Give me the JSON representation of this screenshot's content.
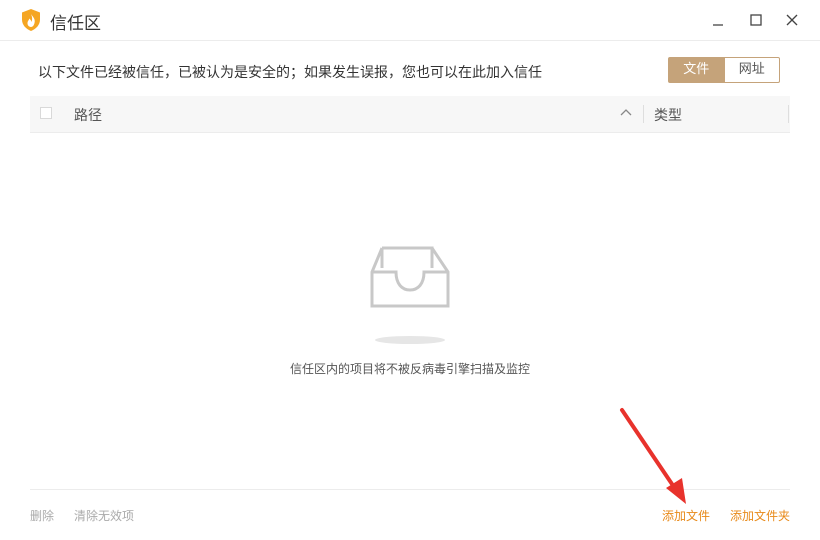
{
  "window": {
    "title": "信任区",
    "icons": {
      "logo": "shield-flame-icon",
      "minimize": "minimize-icon",
      "maximize": "maximize-icon",
      "close": "close-icon"
    }
  },
  "header": {
    "description": "以下文件已经被信任，已被认为是安全的；如果发生误报，您也可以在此加入信任"
  },
  "segmented": {
    "items": [
      {
        "label": "文件",
        "active": true
      },
      {
        "label": "网址",
        "active": false
      }
    ]
  },
  "table": {
    "columns": {
      "path": "路径",
      "type": "类型"
    },
    "sort_icon": "chevron-up-icon",
    "rows": []
  },
  "empty_state": {
    "icon": "empty-inbox-icon",
    "text": "信任区内的项目将不被反病毒引擎扫描及监控"
  },
  "footer": {
    "delete": "删除",
    "clean_invalid": "清除无效项",
    "add_file": "添加文件",
    "add_folder": "添加文件夹"
  },
  "colors": {
    "accent_brown": "#c5a37a",
    "link_orange": "#e88a1a",
    "annotation_red": "#e8322c",
    "logo_orange": "#f5a623"
  }
}
